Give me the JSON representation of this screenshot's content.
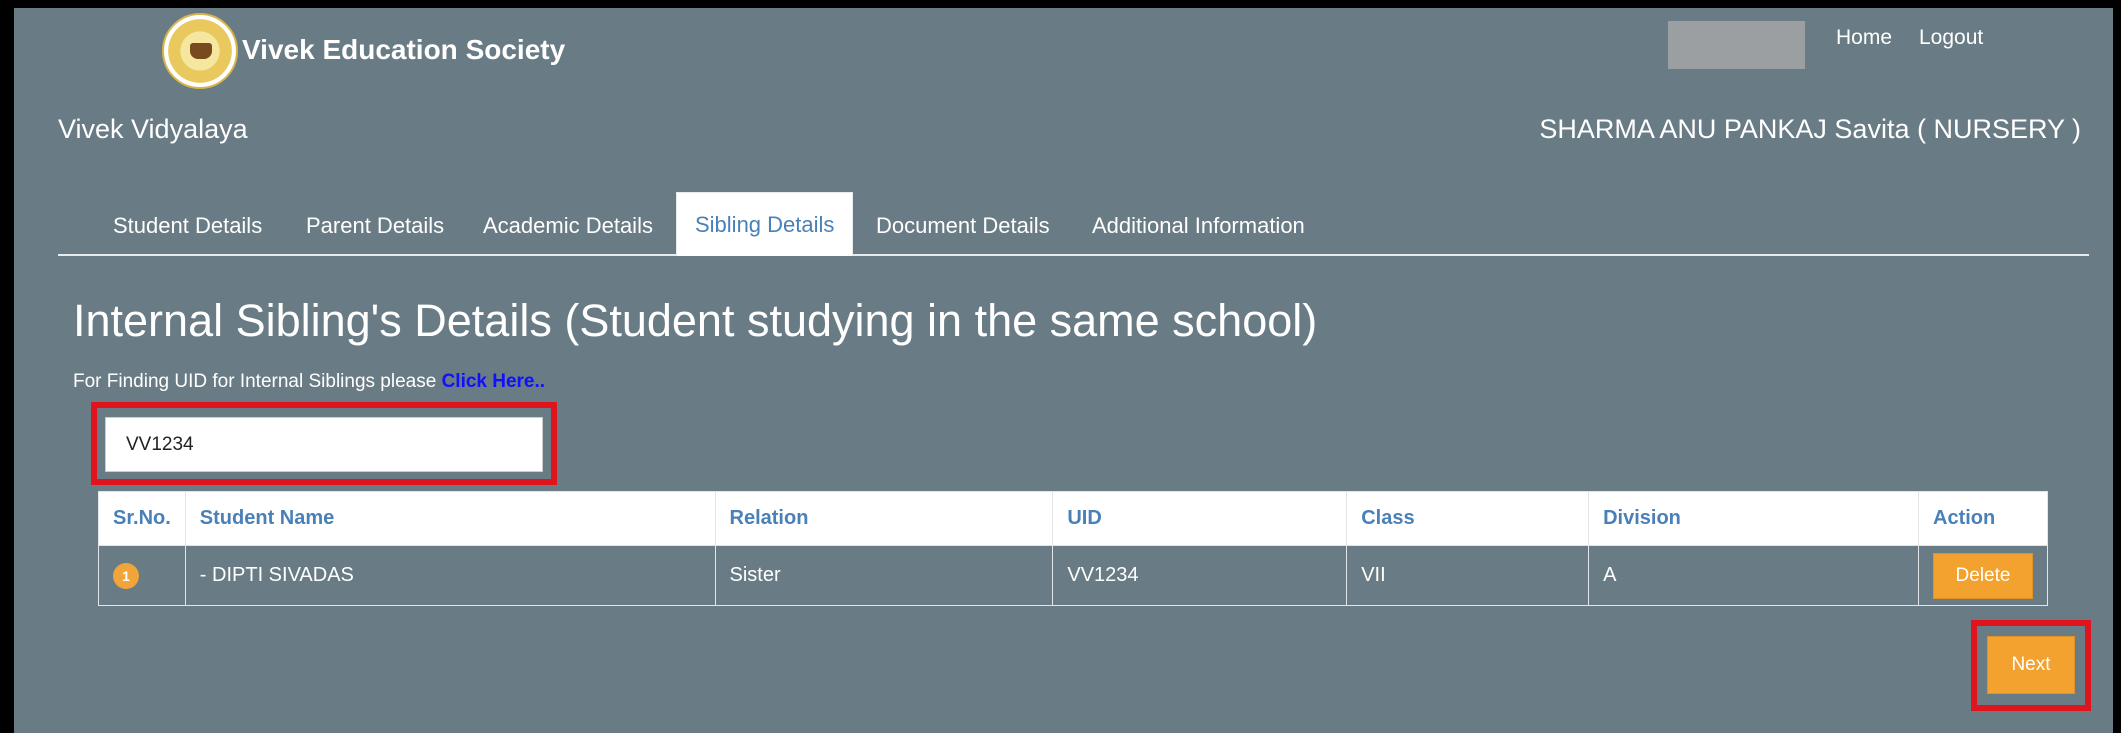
{
  "header": {
    "brand": "Vivek Education Society",
    "links": {
      "home": "Home",
      "logout": "Logout"
    }
  },
  "subheader": {
    "school": "Vivek Vidyalaya",
    "student": "SHARMA ANU PANKAJ Savita ( NURSERY )"
  },
  "tabs": [
    {
      "label": "Student Details"
    },
    {
      "label": "Parent Details"
    },
    {
      "label": "Academic Details"
    },
    {
      "label": "Sibling Details",
      "active": true
    },
    {
      "label": "Document Details"
    },
    {
      "label": "Additional Information"
    }
  ],
  "main": {
    "heading": "Internal Sibling's Details (Student studying in the same school)",
    "finder_text": "For Finding UID for Internal Siblings please ",
    "finder_link": "Click Here..",
    "uid_value": "VV1234"
  },
  "table": {
    "columns": [
      "Sr.No.",
      "Student Name",
      "Relation",
      "UID",
      "Class",
      "Division",
      "Action"
    ],
    "rows": [
      {
        "sr": "1",
        "name": "- DIPTI SIVADAS",
        "relation": "Sister",
        "uid": "VV1234",
        "class": "VII",
        "division": "A",
        "action": "Delete"
      }
    ]
  },
  "actions": {
    "next": "Next"
  },
  "colors": {
    "background": "#697b84",
    "accent": "#f3a22f",
    "tab_text": "#4a80b8",
    "highlight": "#e0141c",
    "link": "#1010ff"
  }
}
